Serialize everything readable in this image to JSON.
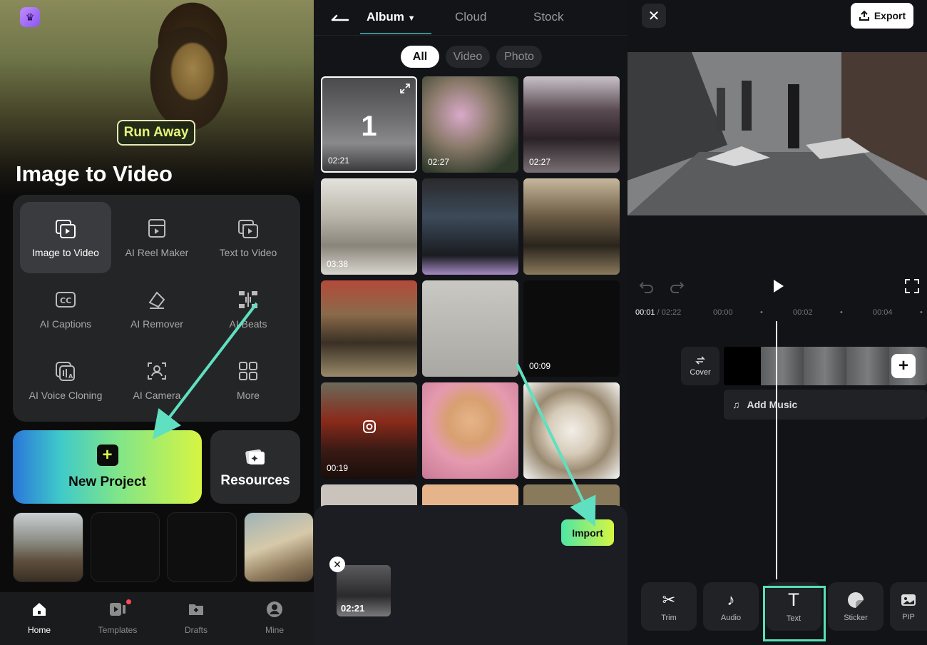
{
  "home": {
    "hero_tag": "Run Away",
    "hero_title": "Image to Video",
    "tools": [
      {
        "label": "Image to Video",
        "icon": "image-to-video-icon"
      },
      {
        "label": "AI Reel Maker",
        "icon": "reel-maker-icon"
      },
      {
        "label": "Text to Video",
        "icon": "text-to-video-icon"
      },
      {
        "label": "AI Captions",
        "icon": "captions-icon"
      },
      {
        "label": "AI Remover",
        "icon": "eraser-icon"
      },
      {
        "label": "AI Beats",
        "icon": "beats-icon"
      },
      {
        "label": "AI Voice Cloning",
        "icon": "voice-cloning-icon"
      },
      {
        "label": "AI Camera",
        "icon": "camera-icon"
      },
      {
        "label": "More",
        "icon": "grid-icon"
      }
    ],
    "new_project_label": "New Project",
    "resources_label": "Resources",
    "nav": [
      {
        "label": "Home",
        "icon": "home-icon"
      },
      {
        "label": "Templates",
        "icon": "templates-icon"
      },
      {
        "label": "Drafts",
        "icon": "drafts-icon"
      },
      {
        "label": "Mine",
        "icon": "user-icon"
      }
    ]
  },
  "album": {
    "tabs": [
      "Album",
      "Cloud",
      "Stock"
    ],
    "filters": [
      "All",
      "Video",
      "Photo"
    ],
    "selected_index": "1",
    "thumbnails": [
      {
        "duration": "02:21"
      },
      {
        "duration": "02:27"
      },
      {
        "duration": "02:27"
      },
      {
        "duration": "03:38"
      },
      {
        "duration": ""
      },
      {
        "duration": ""
      },
      {
        "duration": ""
      },
      {
        "duration": ""
      },
      {
        "duration": "00:09"
      },
      {
        "duration": "00:19"
      },
      {
        "duration": ""
      },
      {
        "duration": ""
      }
    ],
    "import_label": "Import",
    "tray_duration": "02:21"
  },
  "editor": {
    "export_label": "Export",
    "time_current": "00:01",
    "time_total": "/ 02:22",
    "ruler": [
      "00:00",
      "00:02",
      "00:04"
    ],
    "cover_label": "Cover",
    "add_music_label": "Add Music",
    "tools": [
      "Trim",
      "Audio",
      "Text",
      "Sticker",
      "PIP"
    ]
  },
  "colors": {
    "accent_green": "#56e0b8",
    "lime": "#d7f542",
    "arrow": "#5fe0c0"
  }
}
